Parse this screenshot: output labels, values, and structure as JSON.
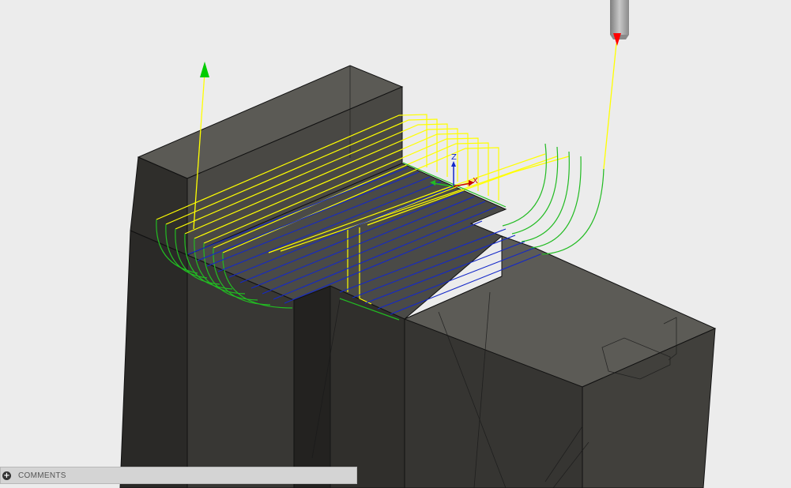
{
  "viewport": {
    "triad_labels": {
      "z": "Z",
      "x": "X"
    }
  },
  "comments": {
    "label": "COMMENTS",
    "expand_symbol": "+"
  },
  "colors": {
    "background": "#ececec",
    "stock_dark": "#3b3a37",
    "toolpath_rapid": "#ffff00",
    "toolpath_lead": "#22bb22",
    "toolpath_cut": "#1428c8",
    "start_arrow": "#00cc00",
    "end_arrow": "#ff0000",
    "tool_body": "#9a9a9a"
  }
}
